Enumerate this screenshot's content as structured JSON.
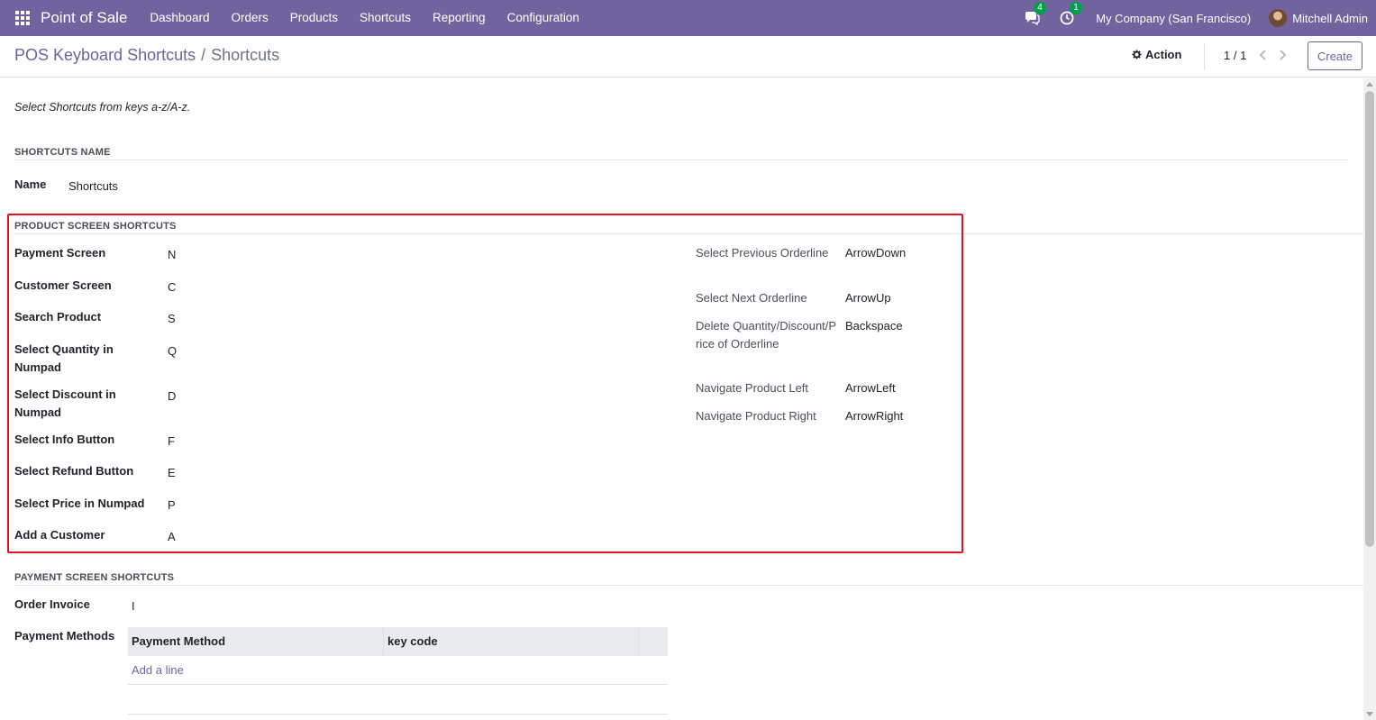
{
  "navbar": {
    "brand": "Point of Sale",
    "menu": [
      "Dashboard",
      "Orders",
      "Products",
      "Shortcuts",
      "Reporting",
      "Configuration"
    ],
    "messages_count": "4",
    "activities_count": "1",
    "company": "My Company (San Francisco)",
    "user": "Mitchell Admin"
  },
  "breadcrumb": {
    "parent": "POS Keyboard Shortcuts",
    "separator": "/",
    "current": "Shortcuts"
  },
  "control": {
    "action_label": "Action",
    "pager": "1 / 1",
    "create_label": "Create"
  },
  "form": {
    "note": "Select Shortcuts from keys a-z/A-z.",
    "name_section": {
      "title": "SHORTCUTS NAME",
      "name_label": "Name",
      "name_value": "Shortcuts"
    },
    "product_section": {
      "title": "PRODUCT SCREEN SHORTCUTS",
      "left": [
        {
          "label": "Payment Screen",
          "value": "N"
        },
        {
          "label": "Customer Screen",
          "value": "C"
        },
        {
          "label": "Search Product",
          "value": "S"
        },
        {
          "label": "Select Quantity in Numpad",
          "value": "Q"
        },
        {
          "label": "Select Discount in Numpad",
          "value": "D"
        },
        {
          "label": "Select Info Button",
          "value": "F"
        },
        {
          "label": "Select Refund Button",
          "value": "E"
        },
        {
          "label": "Select Price in Numpad",
          "value": "P"
        },
        {
          "label": "Add a Customer",
          "value": "A"
        }
      ],
      "right": [
        {
          "label": "Select Previous Orderline",
          "value": "ArrowDown"
        },
        {
          "label": "Select Next Orderline",
          "value": "ArrowUp"
        },
        {
          "label": "Delete Quantity/Discount/Price of Orderline",
          "value": "Backspace"
        },
        {
          "label": "Navigate Product Left",
          "value": "ArrowLeft"
        },
        {
          "label": "Navigate Product Right",
          "value": "ArrowRight"
        }
      ]
    },
    "payment_section": {
      "title": "PAYMENT SCREEN SHORTCUTS",
      "invoice_label": "Order Invoice",
      "invoice_value": "I",
      "methods_label": "Payment Methods",
      "table_headers": [
        "Payment Method",
        "key code"
      ],
      "add_line": "Add a line"
    }
  },
  "colors": {
    "primary": "#71639e",
    "highlight": "#e2141d",
    "badge": "#00a04a"
  }
}
